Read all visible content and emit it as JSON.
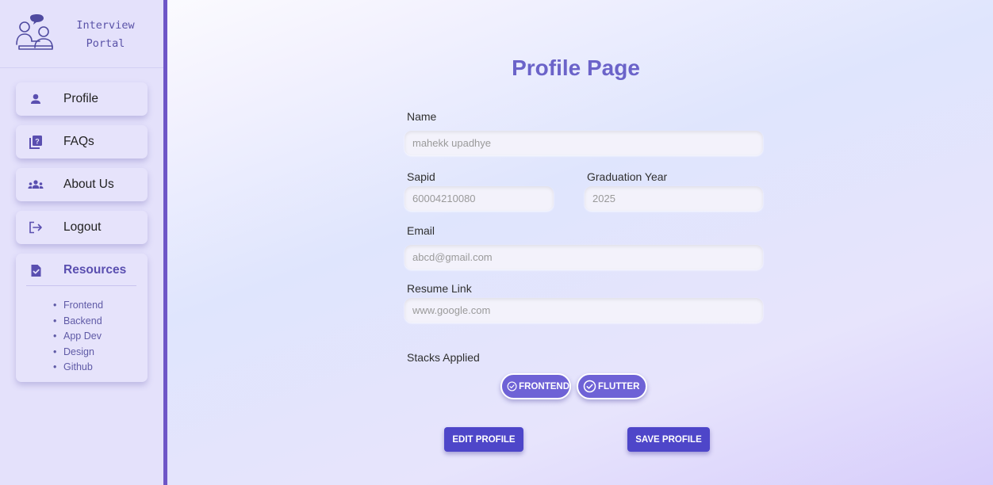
{
  "brand": {
    "title": "Interview Portal",
    "logo_icon": "interview-people-icon"
  },
  "sidebar": {
    "items": [
      {
        "label": "Profile",
        "icon": "person-icon"
      },
      {
        "label": "FAQs",
        "icon": "question-book-icon"
      },
      {
        "label": "About Us",
        "icon": "group-icon"
      },
      {
        "label": "Logout",
        "icon": "logout-icon"
      }
    ],
    "resources": {
      "title": "Resources",
      "icon": "document-check-icon",
      "links": [
        "Frontend",
        "Backend",
        "App Dev",
        "Design",
        "Github"
      ]
    }
  },
  "main": {
    "title": "Profile Page",
    "name": {
      "label": "Name",
      "placeholder": "mahekk upadhye"
    },
    "sapid": {
      "label": "Sapid",
      "placeholder": "60004210080"
    },
    "graduation_year": {
      "label": "Graduation Year",
      "placeholder": "2025"
    },
    "email": {
      "label": "Email",
      "placeholder": "abcd@gmail.com"
    },
    "resume_link": {
      "label": "Resume Link",
      "placeholder": "www.google.com"
    },
    "stacks": {
      "label": "Stacks Applied",
      "items": [
        "FRONTEND",
        "FLUTTER"
      ]
    },
    "edit_button": "EDIT PROFILE",
    "save_button": "SAVE PROFILE"
  },
  "colors": {
    "accent": "#6b63c9",
    "sidebar_border": "#6e56c7",
    "button": "#4e46c9"
  }
}
